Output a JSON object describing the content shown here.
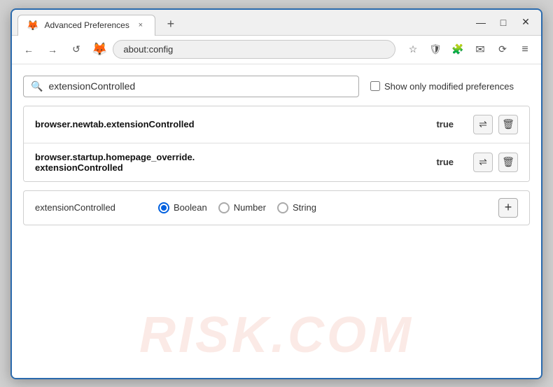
{
  "window": {
    "title": "Advanced Preferences",
    "url": "about:config",
    "browser_name": "Firefox"
  },
  "tab": {
    "label": "Advanced Preferences",
    "close": "×",
    "add": "+"
  },
  "window_controls": {
    "minimize": "—",
    "maximize": "□",
    "close": "✕"
  },
  "nav": {
    "back": "←",
    "forward": "→",
    "refresh": "↺",
    "bookmark": "☆",
    "shield": "🛡",
    "extension": "🧩",
    "menu": "≡"
  },
  "search": {
    "placeholder": "extensionControlled",
    "value": "extensionControlled",
    "show_modified_label": "Show only modified preferences"
  },
  "results": [
    {
      "name": "browser.newtab.extensionControlled",
      "value": "true"
    },
    {
      "name_line1": "browser.startup.homepage_override.",
      "name_line2": "extensionControlled",
      "value": "true"
    }
  ],
  "add_pref": {
    "name": "extensionControlled",
    "types": [
      "Boolean",
      "Number",
      "String"
    ],
    "selected_type": "Boolean",
    "add_btn": "+"
  },
  "watermark": "RISK.COM",
  "icons": {
    "search": "🔍",
    "toggle": "⇌",
    "delete": "🗑",
    "firefox": "🦊"
  }
}
